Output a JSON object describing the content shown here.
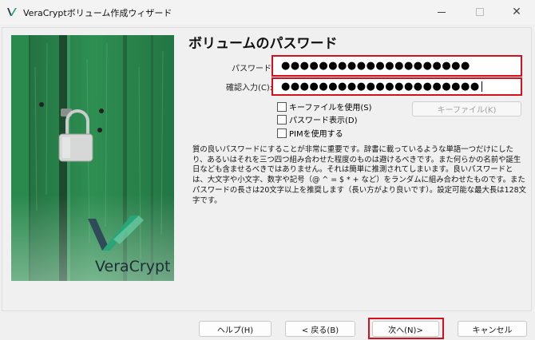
{
  "window": {
    "title": "VeraCryptボリューム作成ウィザード",
    "close_glyph": "✕"
  },
  "banner": {
    "brand": "VeraCrypt"
  },
  "page": {
    "title": "ボリュームのパスワード"
  },
  "form": {
    "password_label": "パスワード",
    "password_value": "●●●●●●●●●●●●●●●●●●●●",
    "confirm_label": "確認入力(C):",
    "confirm_value": "●●●●●●●●●●●●●●●●●●●●●",
    "use_keyfiles_label": "キーファイルを使用(S)",
    "use_keyfiles_checked": false,
    "display_password_label": "パスワード表示(D)",
    "display_password_checked": false,
    "use_pim_label": "PIMを使用する",
    "use_pim_checked": false,
    "keyfiles_button_label": "キーファイル(K)"
  },
  "description": "質の良いパスワードにすることが非常に重要です。辞書に載っているような単語一つだけにしたり、あるいはそれを三つ四つ組み合わせた程度のものは避けるべきです。また何らかの名前や誕生日なども含ませるべきではありません。それは簡単に推測されてしまいます。良いパスワードとは、大文字や小文字、数字や記号（@ ^ = $ * + など）をランダムに組み合わせたものです。またパスワードの長さは20文字以上を推奨します（長い方がより良いです）。設定可能な最大長は128文字です。",
  "buttons": {
    "help": "ヘルプ(H)",
    "back": "< 戻る(B)",
    "next": "次へ(N)>",
    "cancel": "キャンセル"
  },
  "colors": {
    "highlight": "#d40f1e",
    "banner_green": "#2e8f52"
  }
}
